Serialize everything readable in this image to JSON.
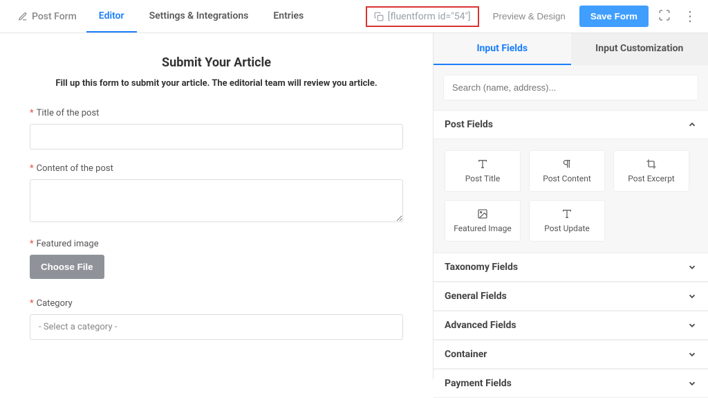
{
  "topbar": {
    "brand": "Post Form",
    "tabs": [
      "Editor",
      "Settings & Integrations",
      "Entries"
    ],
    "active_tab_index": 0,
    "shortcode": "[fluentform id=\"54\"]",
    "preview_label": "Preview & Design",
    "save_label": "Save Form"
  },
  "form": {
    "title": "Submit Your Article",
    "description": "Fill up this form to submit your article. The editorial team will review you article.",
    "fields": {
      "title_label": "Title of the post",
      "content_label": "Content of the post",
      "image_label": "Featured image",
      "choose_file_label": "Choose File",
      "category_label": "Category",
      "category_placeholder": "- Select a category -"
    }
  },
  "sidebar": {
    "tabs": [
      "Input Fields",
      "Input Customization"
    ],
    "active_tab_index": 0,
    "search_placeholder": "Search (name, address)...",
    "sections": {
      "post_fields": {
        "label": "Post Fields",
        "blocks": [
          "Post Title",
          "Post Content",
          "Post Excerpt",
          "Featured Image",
          "Post Update"
        ]
      },
      "taxonomy": "Taxonomy Fields",
      "general": "General Fields",
      "advanced": "Advanced Fields",
      "container": "Container",
      "payment": "Payment Fields"
    }
  }
}
